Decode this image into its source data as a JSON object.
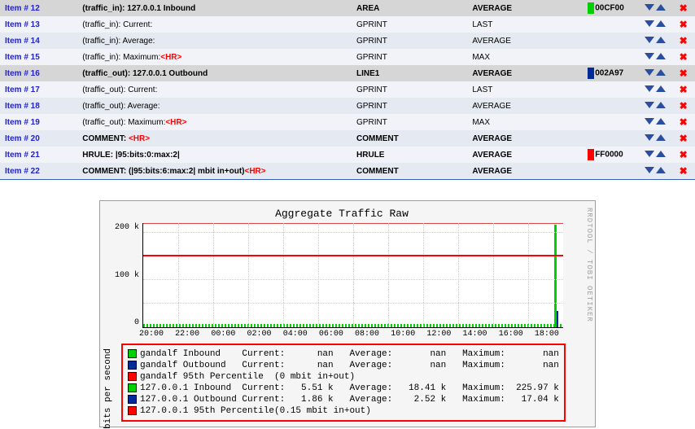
{
  "rows": [
    {
      "n": "Item # 12",
      "descPre": "(traffic_in): 127.0.0.1 Inbound",
      "descRed": "",
      "type": "AREA",
      "cf": "AVERAGE",
      "color": "#00CF00",
      "colorTxt": "00CF00",
      "hl": true,
      "bold": true
    },
    {
      "n": "Item # 13",
      "descPre": "(traffic_in): Current:",
      "descRed": "",
      "type": "GPRINT",
      "cf": "LAST",
      "color": "",
      "colorTxt": "",
      "hl": false,
      "bold": false
    },
    {
      "n": "Item # 14",
      "descPre": "(traffic_in): Average:",
      "descRed": "",
      "type": "GPRINT",
      "cf": "AVERAGE",
      "color": "",
      "colorTxt": "",
      "hl": false,
      "bold": false
    },
    {
      "n": "Item # 15",
      "descPre": "(traffic_in): Maximum:",
      "descRed": "<HR>",
      "type": "GPRINT",
      "cf": "MAX",
      "color": "",
      "colorTxt": "",
      "hl": false,
      "bold": false
    },
    {
      "n": "Item # 16",
      "descPre": "(traffic_out): 127.0.0.1 Outbound",
      "descRed": "",
      "type": "LINE1",
      "cf": "AVERAGE",
      "color": "#002A97",
      "colorTxt": "002A97",
      "hl": true,
      "bold": true
    },
    {
      "n": "Item # 17",
      "descPre": "(traffic_out): Current:",
      "descRed": "",
      "type": "GPRINT",
      "cf": "LAST",
      "color": "",
      "colorTxt": "",
      "hl": false,
      "bold": false
    },
    {
      "n": "Item # 18",
      "descPre": "(traffic_out): Average:",
      "descRed": "",
      "type": "GPRINT",
      "cf": "AVERAGE",
      "color": "",
      "colorTxt": "",
      "hl": false,
      "bold": false
    },
    {
      "n": "Item # 19",
      "descPre": "(traffic_out): Maximum:",
      "descRed": "<HR>",
      "type": "GPRINT",
      "cf": "MAX",
      "color": "",
      "colorTxt": "",
      "hl": false,
      "bold": false
    },
    {
      "n": "Item # 20",
      "descPre": "COMMENT: ",
      "descRed": "<HR>",
      "type": "COMMENT",
      "cf": "AVERAGE",
      "color": "",
      "colorTxt": "",
      "hl": false,
      "bold": true
    },
    {
      "n": "Item # 21",
      "descPre": "HRULE: |95:bits:0:max:2|",
      "descRed": "",
      "type": "HRULE",
      "cf": "AVERAGE",
      "color": "#FF0000",
      "colorTxt": "FF0000",
      "hl": false,
      "bold": true
    },
    {
      "n": "Item # 22",
      "descPre": "COMMENT: (|95:bits:6:max:2| mbit in+out)",
      "descRed": "<HR>",
      "type": "COMMENT",
      "cf": "AVERAGE",
      "color": "",
      "colorTxt": "",
      "hl": false,
      "bold": true
    }
  ],
  "chart_data": {
    "type": "line",
    "title": "Aggregate Traffic Raw",
    "ylabel": "bits per second",
    "ylim": [
      0,
      220000
    ],
    "yticks": [
      "200 k",
      "100 k",
      "0"
    ],
    "xticks": [
      "20:00",
      "22:00",
      "00:00",
      "02:00",
      "04:00",
      "06:00",
      "08:00",
      "10:00",
      "12:00",
      "14:00",
      "16:00",
      "18:00"
    ],
    "hrule": 150000,
    "side": "RRDTOOL / TOBI OETIKER",
    "series": [
      {
        "name": "gandalf Inbound",
        "color": "#00CF00",
        "current": "nan",
        "average": "nan",
        "maximum": "nan"
      },
      {
        "name": "gandalf Outbound",
        "color": "#002A97",
        "current": "nan",
        "average": "nan",
        "maximum": "nan"
      },
      {
        "name": "gandalf 95th Percentile",
        "color": "#FF0000",
        "note": "(0 mbit in+out)"
      },
      {
        "name": "127.0.0.1 Inbound",
        "color": "#00CF00",
        "current": "5.51 k",
        "average": "18.41 k",
        "maximum": "225.97 k"
      },
      {
        "name": "127.0.0.1 Outbound",
        "color": "#002A97",
        "current": "1.86 k",
        "average": "2.52 k",
        "maximum": "17.04 k"
      },
      {
        "name": "127.0.0.1 95th Percentile",
        "color": "#FF0000",
        "note": "(0.15 mbit in+out)"
      }
    ]
  }
}
